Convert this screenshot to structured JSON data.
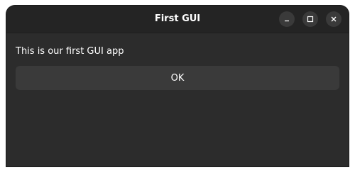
{
  "window": {
    "title": "First GUI",
    "controls": {
      "minimize_icon": "minimize-icon",
      "maximize_icon": "maximize-icon",
      "close_icon": "close-icon"
    }
  },
  "main": {
    "label": "This is our first GUI app",
    "ok_button_label": "OK"
  },
  "colors": {
    "window_bg": "#2c2c2c",
    "titlebar_bg": "#242424",
    "button_bg": "#3a3a3a",
    "text": "#ffffff"
  }
}
